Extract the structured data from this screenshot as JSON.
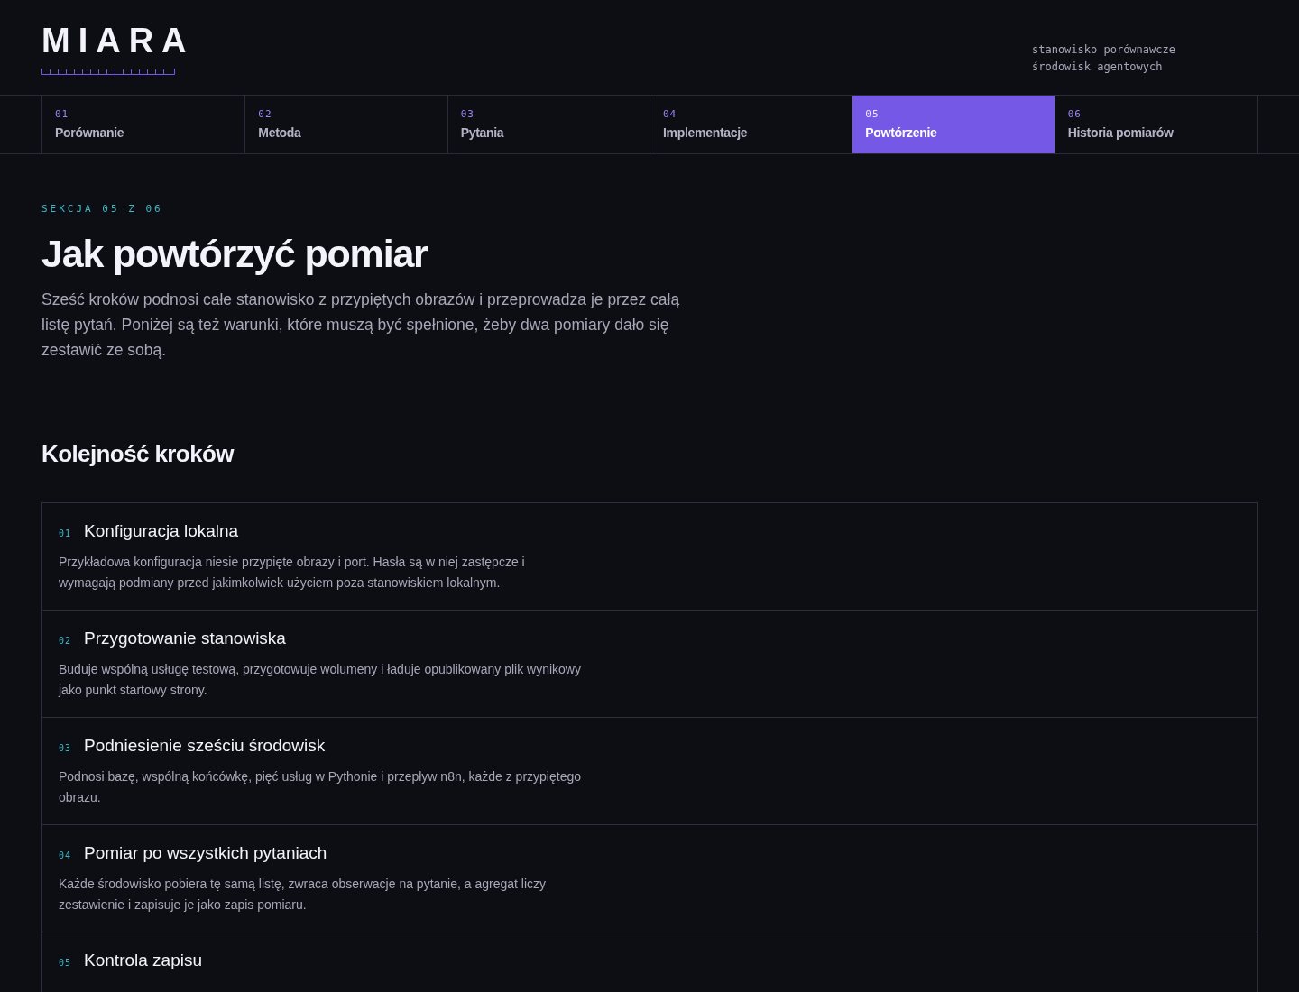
{
  "logo": "MIARA",
  "tagline": [
    "stanowisko porównawcze",
    "środowisk agentowych"
  ],
  "tabs": [
    {
      "number": "01",
      "label": "Porównanie",
      "selected": false
    },
    {
      "number": "02",
      "label": "Metoda",
      "selected": false
    },
    {
      "number": "03",
      "label": "Pytania",
      "selected": false
    },
    {
      "number": "04",
      "label": "Implementacje",
      "selected": false
    },
    {
      "number": "05",
      "label": "Powtórzenie",
      "selected": true
    },
    {
      "number": "06",
      "label": "Historia pomiarów",
      "selected": false
    }
  ],
  "section_label": "SEKCJA 05 Z 06",
  "title": "Jak powtórzyć pomiar",
  "intro": "Sześć kroków podnosi całe stanowisko z przypiętych obrazów i przeprowadza je przez całą listę pytań. Poniżej są też warunki, które muszą być spełnione, żeby dwa pomiary dało się zestawić ze sobą.",
  "steps_heading": "Kolejność kroków",
  "steps": [
    {
      "number": "01",
      "title": "Konfiguracja lokalna",
      "text": "Przykładowa konfiguracja niesie przypięte obrazy i port. Hasła są w niej zastępcze i wymagają podmiany przed jakimkolwiek użyciem poza stanowiskiem lokalnym."
    },
    {
      "number": "02",
      "title": "Przygotowanie stanowiska",
      "text": "Buduje wspólną usługę testową, przygotowuje wolumeny i ładuje opublikowany plik wynikowy jako punkt startowy strony."
    },
    {
      "number": "03",
      "title": "Podniesienie sześciu środowisk",
      "text": "Podnosi bazę, wspólną końcówkę, pięć usług w Pythonie i przepływ n8n, każde z przypiętego obrazu."
    },
    {
      "number": "04",
      "title": "Pomiar po wszystkich pytaniach",
      "text": "Każde środowisko pobiera tę samą listę, zwraca obserwacje na pytanie, a agregat liczy zestawienie i zapisuje je jako zapis pomiaru."
    },
    {
      "number": "05",
      "title": "Kontrola zapisu"
    }
  ]
}
